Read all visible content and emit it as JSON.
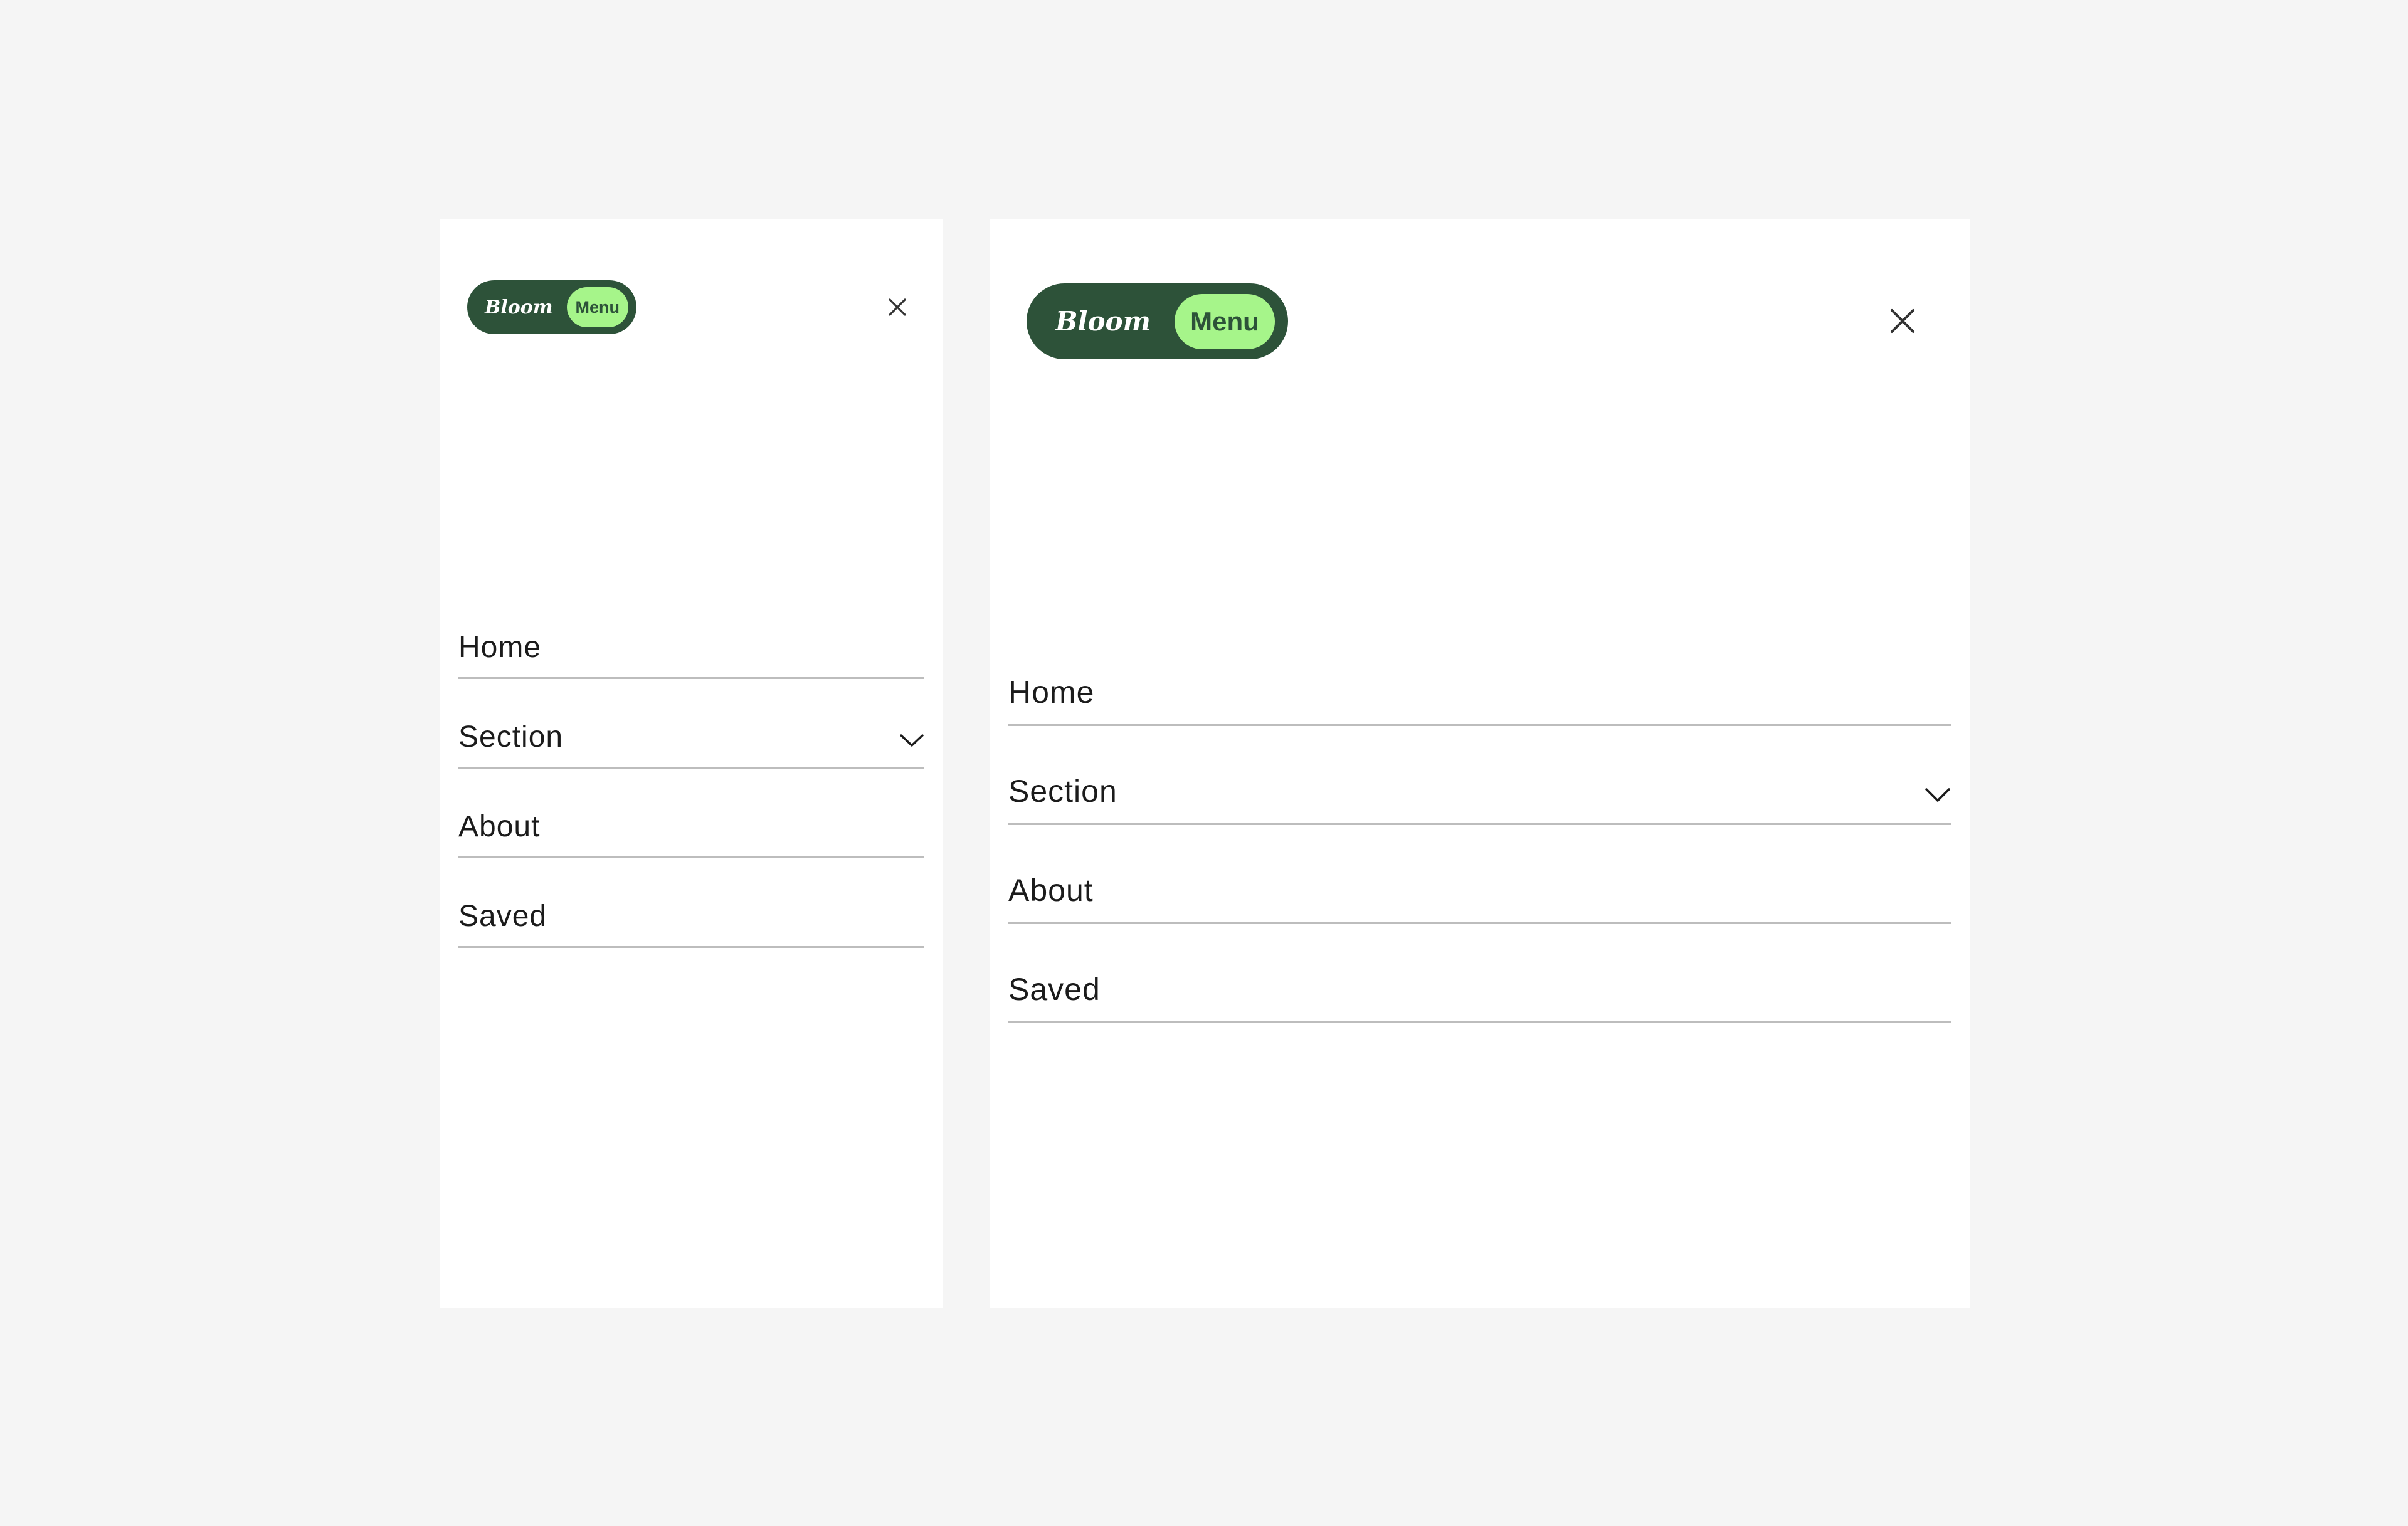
{
  "brand": {
    "name": "Bloom",
    "menu_label": "Menu",
    "colors": {
      "pill": "#2d5239",
      "chip": "#a6f58a",
      "text_dark": "#1b1b1b",
      "divider": "#bdbdbd",
      "background": "#f5f5f5"
    }
  },
  "close_icon": "close-icon",
  "nav_items": [
    {
      "label": "Home",
      "has_chevron": false
    },
    {
      "label": "Section",
      "has_chevron": true,
      "icon": "chevron-down-icon"
    },
    {
      "label": "About",
      "has_chevron": false
    },
    {
      "label": "Saved",
      "has_chevron": false
    }
  ]
}
